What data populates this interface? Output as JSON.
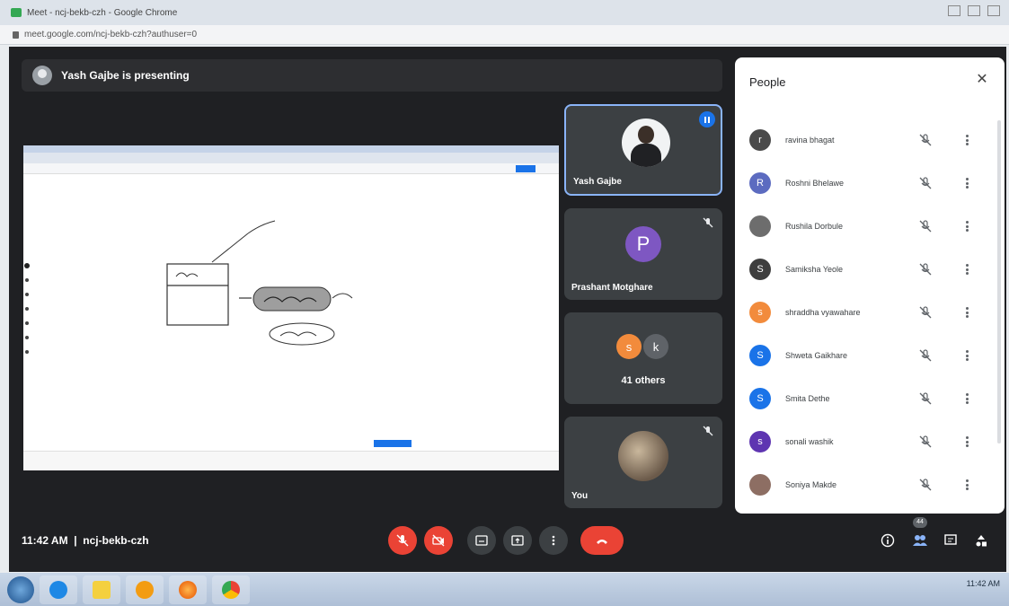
{
  "browser": {
    "window_title": "Meet - ncj-bekb-czh - Google Chrome",
    "url": "meet.google.com/ncj-bekb-czh?authuser=0"
  },
  "meet": {
    "presenting_banner": "Yash Gajbe is presenting",
    "tiles": [
      {
        "name": "Yash Gajbe",
        "speaking": true
      },
      {
        "name": "Prashant Motghare",
        "letter": "P"
      },
      {
        "name": "41 others",
        "letters": [
          "s",
          "k"
        ]
      },
      {
        "name": "You"
      }
    ],
    "clock": "11:42 AM",
    "separator": "|",
    "meeting_code": "ncj-bekb-czh",
    "participant_count": "44"
  },
  "people_panel": {
    "title": "People",
    "participants": [
      {
        "name": "ravina bhagat",
        "initial": "r",
        "color": "#4a4a4a"
      },
      {
        "name": "Roshni Bhelawe",
        "initial": "R",
        "color": "#5c6bc0"
      },
      {
        "name": "Rushila Dorbule",
        "initial": "",
        "color": "#6d6d6d"
      },
      {
        "name": "Samiksha Yeole",
        "initial": "S",
        "color": "#3e3e3e"
      },
      {
        "name": "shraddha vyawahare",
        "initial": "s",
        "color": "#f28b3c"
      },
      {
        "name": "Shweta Gaikhare",
        "initial": "S",
        "color": "#1a73e8"
      },
      {
        "name": "Smita Dethe",
        "initial": "S",
        "color": "#1a73e8"
      },
      {
        "name": "sonali washik",
        "initial": "s",
        "color": "#5e35b1"
      },
      {
        "name": "Soniya Makde",
        "initial": "",
        "color": "#8d6e63"
      }
    ]
  },
  "taskbar": {
    "time": "11:42 AM"
  }
}
